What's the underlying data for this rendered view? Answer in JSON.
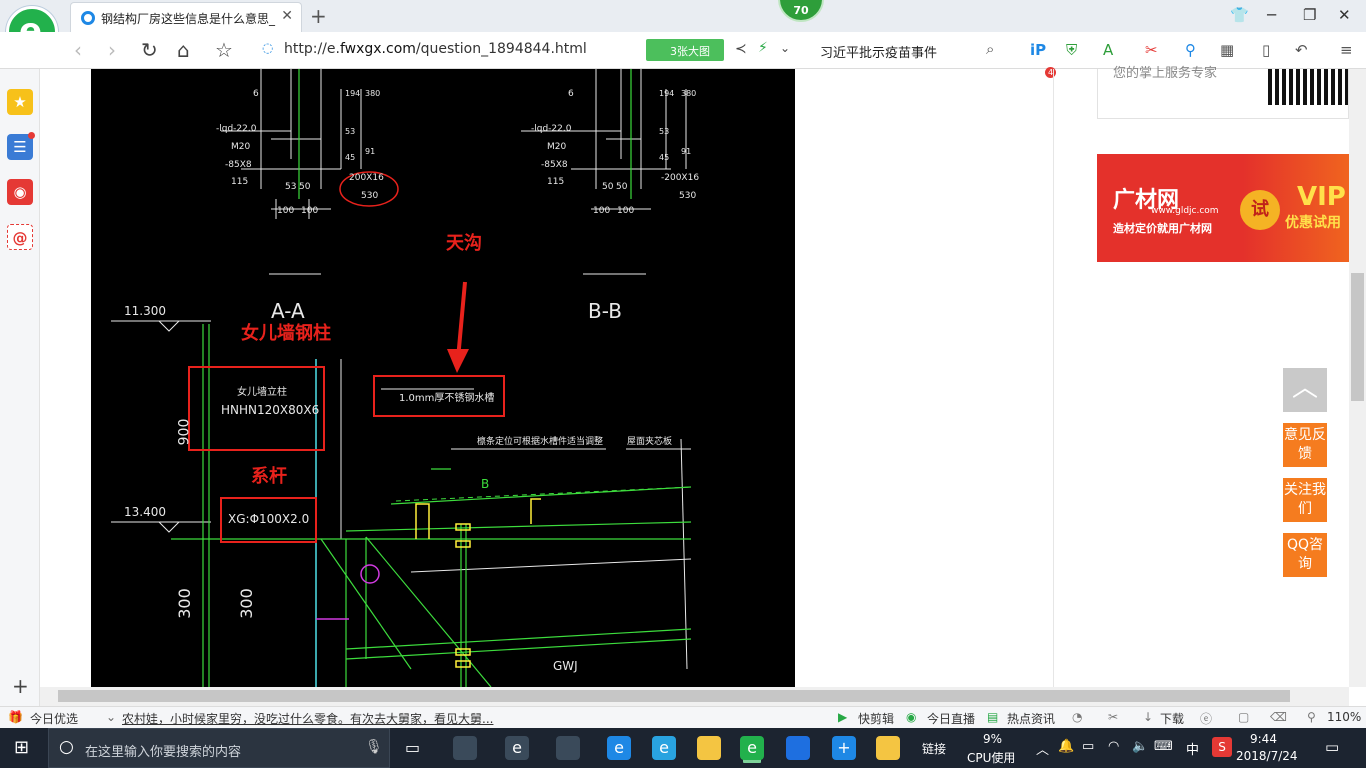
{
  "browser": {
    "tab_title": "钢结构厂房这些信息是什么意思_",
    "badge": "70",
    "url_prefix": "http://e.",
    "url_domain": "fwxgx.com",
    "url_path": "/question_1894844.html",
    "images_button": "3张大图",
    "news_headline": "习近平批示疫苗事件",
    "ext_badge": "4"
  },
  "cad": {
    "section_a": "A-A",
    "section_b": "B-B",
    "dims_a": [
      "6",
      "-lqd-22.0",
      "M20",
      "-85X8",
      "115",
      "53",
      "50",
      "100",
      "100",
      "200X16",
      "530",
      "194",
      "380",
      "53",
      "45",
      "91"
    ],
    "dims_b": [
      "6",
      "-lqd-22.0",
      "M20",
      "-85X8",
      "115",
      "50",
      "50",
      "100",
      "100",
      "-200X16",
      "530",
      "194",
      "380",
      "53",
      "45",
      "91"
    ],
    "label_tiangou": "天沟",
    "label_parapet": "女儿墙钢柱",
    "label_tie": "系杆",
    "elev_top": "11.300",
    "elev_mid": "13.400",
    "parapet_line1": "女儿墙立柱",
    "parapet_line2": "HNHN120X80X6",
    "tie_text": "XG:Φ100X2.0",
    "gutter_text": "1.0mm厚不锈钢水槽",
    "note_purlin": "檩条定位可根据水槽件适当调整",
    "note_roof": "屋面夹芯板",
    "letter_b": "B",
    "dim_900": "900",
    "dim_300a": "300",
    "dim_300b": "300",
    "gwj": "GWJ"
  },
  "right": {
    "qr_text": "您的掌上服务专家",
    "ad_logo": "广材网",
    "ad_url": "www.gldjc.com",
    "ad_slogan": "造材定价就用广材网",
    "ad_try": "试",
    "ad_vip": "VIP",
    "ad_offer": "优惠试用",
    "to_top": "︿",
    "feedback": "意见反馈",
    "follow": "关注我们",
    "qq": "QQ咨询"
  },
  "statusbar": {
    "today": "今日优选",
    "headline": "农村娃，小时候家里穷，没吃过什么零食。有次去大舅家，看见大舅...",
    "quickcut": "快剪辑",
    "live": "今日直播",
    "hot": "热点资讯",
    "download": "下载",
    "zoom": "110%"
  },
  "taskbar": {
    "search_placeholder": "在这里输入你要搜索的内容",
    "link": "链接",
    "cpu_pct": "9%",
    "cpu_label": "CPU使用",
    "ime": "中",
    "time": "9:44",
    "date": "2018/7/24"
  },
  "colors": {
    "green": "#22b14c",
    "cad_red": "#e8221c",
    "cad_green": "#3ddc3d",
    "orange": "#f57c1f"
  }
}
